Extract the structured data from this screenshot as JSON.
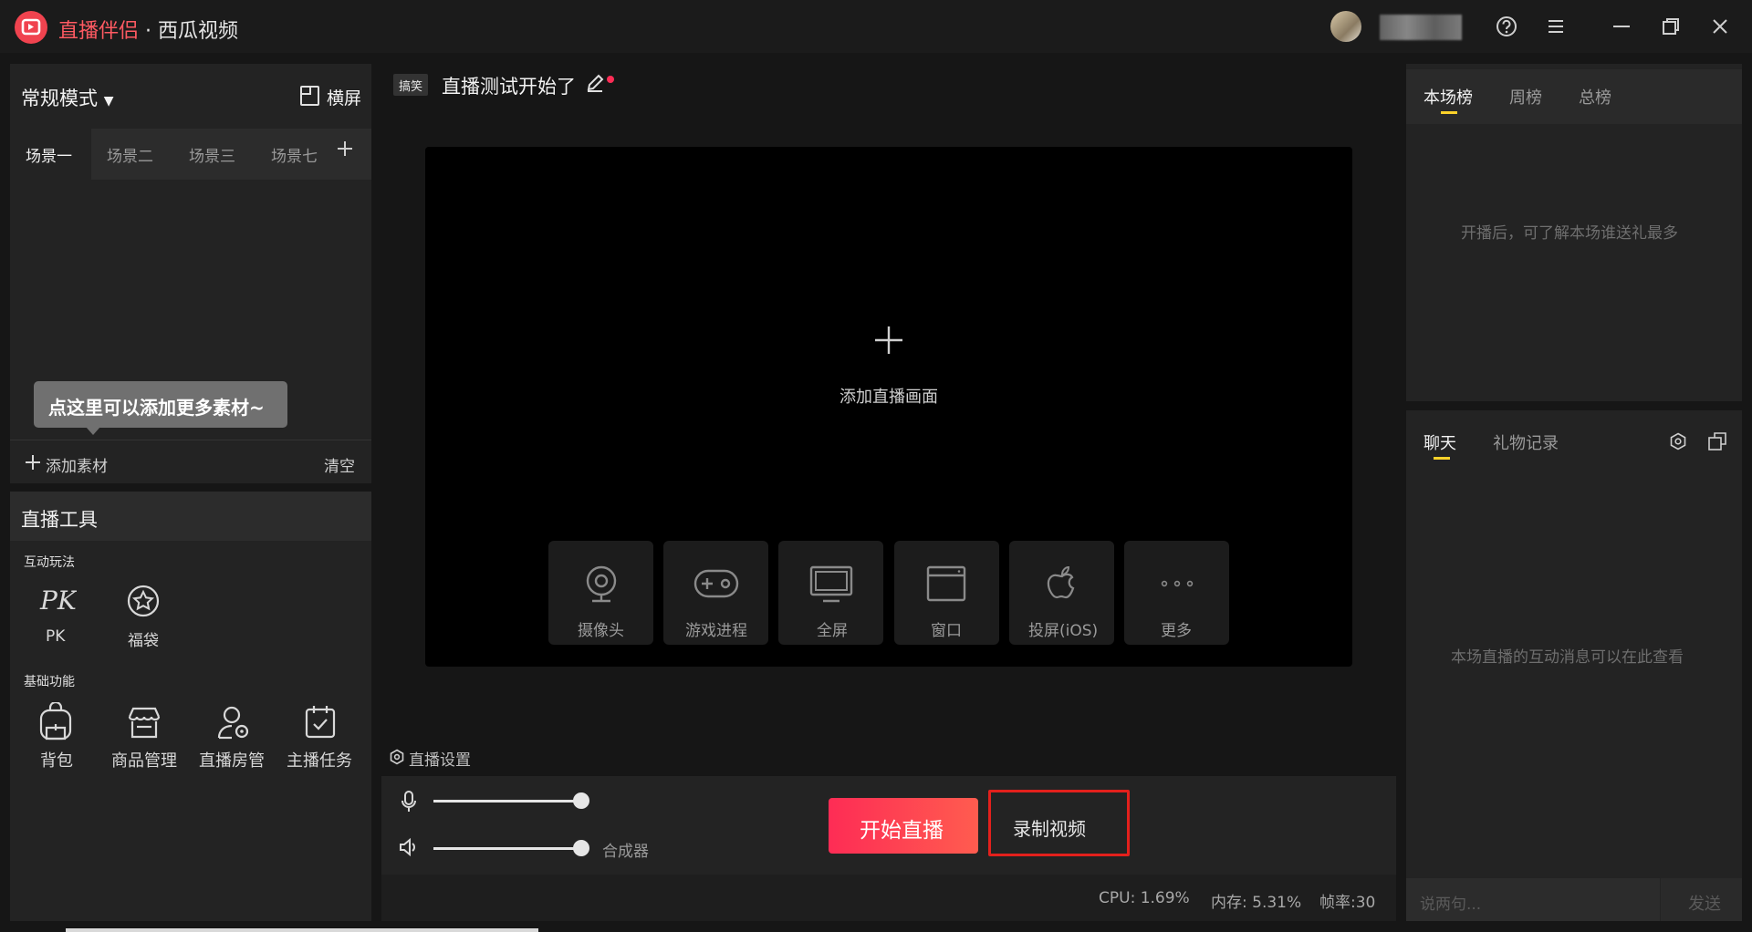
{
  "app": {
    "brand": "直播伴侣",
    "separator": " · ",
    "platform": "西瓜视频"
  },
  "titlebar": {
    "help_icon": "help-circle-icon",
    "menu_icon": "menu-icon",
    "minimize_icon": "minimize-icon",
    "restore_icon": "restore-icon",
    "close_icon": "close-icon"
  },
  "left": {
    "mode_label": "常规模式",
    "orientation_label": "横屏",
    "scenes": [
      "场景一",
      "场景二",
      "场景三",
      "场景七"
    ],
    "tooltip": "点这里可以添加更多素材~",
    "add_material": "添加素材",
    "clear": "清空",
    "tools_title": "直播工具",
    "interactive_section": "互动玩法",
    "interactive_tools": [
      "PK",
      "福袋"
    ],
    "basic_section": "基础功能",
    "basic_tools": [
      "背包",
      "商品管理",
      "直播房管",
      "主播任务"
    ]
  },
  "center": {
    "category_tag": "搞笑",
    "stream_title": "直播测试开始了",
    "add_screen": "添加直播画面",
    "sources": [
      "摄像头",
      "游戏进程",
      "全屏",
      "窗口",
      "投屏(iOS)",
      "更多"
    ],
    "settings_label": "直播设置",
    "mixer_label": "合成器",
    "start_button": "开始直播",
    "record_button": "录制视频",
    "mic_level": 1.0,
    "speaker_level": 1.0,
    "stats": {
      "cpu": "CPU: 1.69%",
      "memory": "内存: 5.31%",
      "fps": "帧率:30"
    }
  },
  "right": {
    "rank_tabs": [
      "本场榜",
      "周榜",
      "总榜"
    ],
    "rank_empty": "开播后，可了解本场谁送礼最多",
    "chat_tabs": [
      "聊天",
      "礼物记录"
    ],
    "chat_empty": "本场直播的互动消息可以在此查看",
    "chat_placeholder": "说两句...",
    "send_button": "发送"
  },
  "colors": {
    "accent_red": "#fe2c55",
    "tab_underline": "#fcd22a",
    "highlight_box": "#e3201c"
  }
}
